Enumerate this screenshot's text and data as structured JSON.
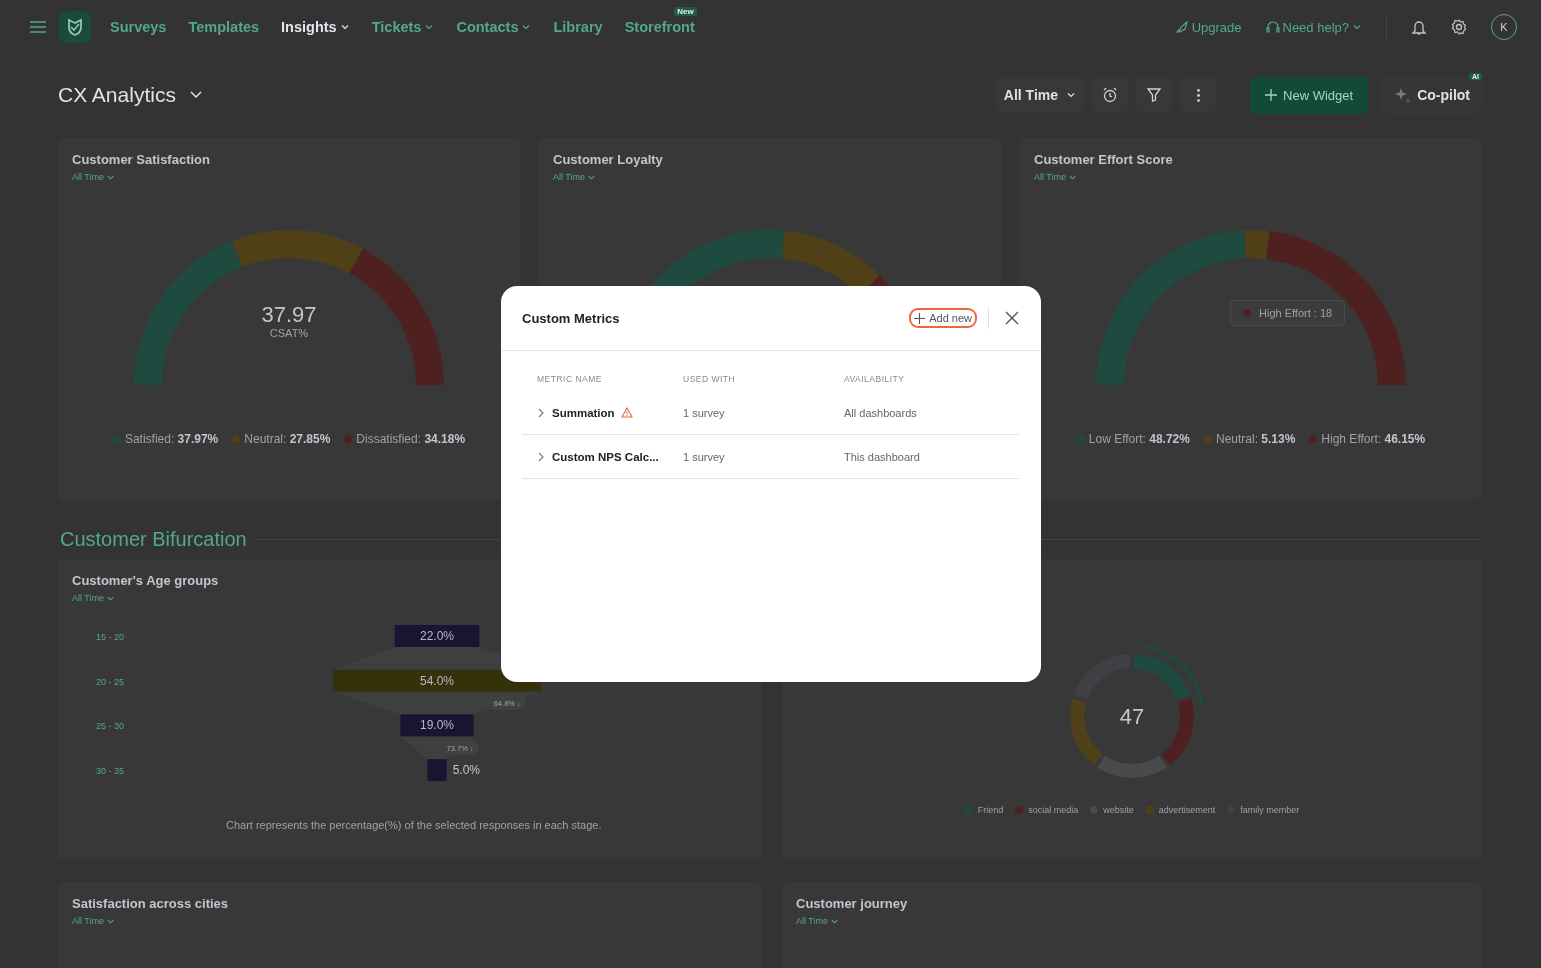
{
  "nav": {
    "items": [
      {
        "label": "Surveys",
        "selected": false,
        "dropdown": false
      },
      {
        "label": "Templates",
        "selected": false,
        "dropdown": false
      },
      {
        "label": "Insights",
        "selected": true,
        "dropdown": true
      },
      {
        "label": "Tickets",
        "selected": false,
        "dropdown": true
      },
      {
        "label": "Contacts",
        "selected": false,
        "dropdown": true
      },
      {
        "label": "Library",
        "selected": false,
        "dropdown": false
      },
      {
        "label": "Storefront",
        "selected": false,
        "dropdown": false,
        "badge": "New"
      }
    ],
    "upgrade": "Upgrade",
    "help": "Need help?",
    "avatar": "K"
  },
  "dashboard": {
    "title": "CX Analytics",
    "range": "All Time",
    "new_widget": "New Widget",
    "copilot": "Co-pilot",
    "copilot_badge": "AI"
  },
  "gauge_cards": [
    {
      "kind": "gauge",
      "title": "Customer Satisfaction",
      "range": "All Time",
      "center_value": "37.97",
      "center_label": "CSAT%",
      "legend": [
        {
          "label": "Satisfied:",
          "value": "37.97%",
          "color": "#1f4a3f"
        },
        {
          "label": "Neutral:",
          "value": "27.85%",
          "color": "#4f4018"
        },
        {
          "label": "Dissatisfied:",
          "value": "34.18%",
          "color": "#4f2020"
        }
      ]
    },
    {
      "kind": "gauge",
      "title": "Customer Loyalty",
      "range": "All Time"
    },
    {
      "kind": "gauge",
      "title": "Customer Effort Score",
      "range": "All Time",
      "tooltip": {
        "label": "High Effort : 18",
        "color": "#4f2020"
      },
      "legend": [
        {
          "label": "Low Effort:",
          "value": "48.72%",
          "color": "#1f4a3f"
        },
        {
          "label": "Neutral:",
          "value": "5.13%",
          "color": "#4f4018"
        },
        {
          "label": "High Effort:",
          "value": "46.15%",
          "color": "#4f2020"
        }
      ]
    }
  ],
  "section": {
    "title": "Customer Bifurcation"
  },
  "age_card": {
    "title": "Customer's Age groups",
    "range": "All Time",
    "stages": [
      {
        "label": "15 - 20",
        "value": "22.0%",
        "selected": false
      },
      {
        "label": "20 - 25",
        "value": "54.0%",
        "selected": true,
        "drop_off": "64.8% ↓"
      },
      {
        "label": "25 - 30",
        "value": "19.0%",
        "selected": false,
        "drop_off": "73.7% ↓"
      },
      {
        "label": "30 - 35",
        "value": "5.0%",
        "selected": false
      }
    ],
    "caption": "Chart represents the percentage(%) of the selected responses in each stage."
  },
  "source_card": {
    "center_value": "47",
    "legend": [
      {
        "label": "Friend",
        "color": "#1f4a3f"
      },
      {
        "label": "social media",
        "color": "#4f2020"
      },
      {
        "label": "website",
        "color": "#4a4a4a"
      },
      {
        "label": "advertisement",
        "color": "#4f4018"
      },
      {
        "label": "family member",
        "color": "#3f3f46"
      }
    ]
  },
  "bottom_cards": [
    {
      "title": "Satisfaction across cities",
      "range": "All Time"
    },
    {
      "title": "Customer journey",
      "range": "All Time"
    }
  ],
  "modal": {
    "title": "Custom Metrics",
    "add_label": "Add new",
    "columns": [
      "METRIC NAME",
      "USED WITH",
      "AVAILABILITY"
    ],
    "rows": [
      {
        "name": "Summation",
        "warning": true,
        "expanded": false,
        "used_with": "1 survey",
        "availability": "All dashboards"
      },
      {
        "name": "Custom NPS Calc...",
        "warning": false,
        "expanded": false,
        "used_with": "1 survey",
        "availability": "This dashboard"
      }
    ]
  }
}
